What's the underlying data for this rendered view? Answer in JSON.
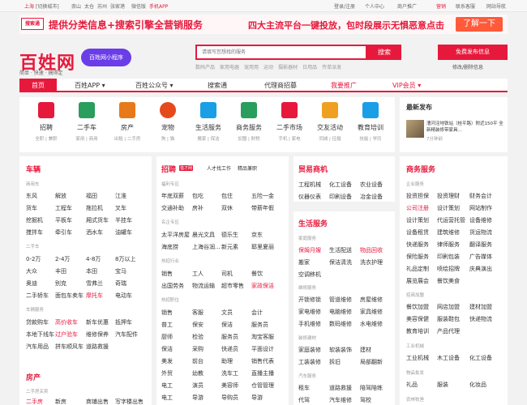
{
  "topbar": {
    "city": "上海",
    "switch": "[切换城市]",
    "areas": [
      "崇山",
      "太仓",
      "苏州",
      "张家港"
    ],
    "wechat": "微信版",
    "mobile": "手机APP",
    "right": [
      "登录/注册",
      "个人中心",
      "商户推广",
      "营销",
      "联系客服",
      "网站导航"
    ]
  },
  "banner": {
    "logo": "搜索通",
    "text1": "提供分类信息+搜索引擎全营销服务",
    "text2": "四大主流平台一键投放，包时段展示无惧恶意点击",
    "button": "了解一下"
  },
  "header": {
    "logo": "百姓网",
    "slogan": "简单 · 快速 · 搞得定",
    "mini": "百姓网小程序",
    "search_placeholder": "请填写您想找的服务",
    "search_button": "搜索",
    "hot": [
      "数码产品",
      "家用电器",
      "宠用用",
      "运动",
      "摄影器材",
      "日用品",
      "传单派发"
    ],
    "post_button": "免费发布信息",
    "post_sub": "修改/删除信息"
  },
  "nav": [
    "首页",
    "百姓APP ▾",
    "百姓公众号 ▾",
    "搜索通",
    "代理商招募",
    "我要推广",
    "VIP会员 ▾"
  ],
  "cats": [
    {
      "name": "招聘",
      "sub": "全职 | 兼职",
      "color": "#e6193c"
    },
    {
      "name": "二手车",
      "sub": "家用 | 商用",
      "color": "#2a9e5c"
    },
    {
      "name": "房产",
      "sub": "出租 | 二手房",
      "color": "#e67a1a"
    },
    {
      "name": "宠物",
      "sub": "狗 | 猫",
      "color": "#e64a1a"
    },
    {
      "name": "生活服务",
      "sub": "搬家 | 保洁",
      "color": "#1a9ee6"
    },
    {
      "name": "商务服务",
      "sub": "加盟 | 财税",
      "color": "#2a9e5c"
    },
    {
      "name": "二手市场",
      "sub": "手机 | 家电",
      "color": "#e6193c"
    },
    {
      "name": "交友活动",
      "sub": "同城 | 征婚",
      "color": "#f0a020"
    },
    {
      "name": "教育培训",
      "sub": "技能 | 学历",
      "color": "#1a9ee6"
    }
  ],
  "latest": {
    "title": "最新发布",
    "post": "漕河泾地铁站（桂平路）附近150平 全新精装修带家具...",
    "time": "7分钟前"
  },
  "col1": {
    "vehicle": {
      "title": "车辆",
      "sub1": "商用车",
      "row1": [
        "东风",
        "解放",
        "福田",
        "江淮"
      ],
      "row2": [
        "货车",
        "工程车",
        "拖拉机",
        "叉车"
      ],
      "row3": [
        "挖掘机",
        "平板车",
        "厢式货车",
        "半挂车"
      ],
      "row4": [
        "搅拌车",
        "牵引车",
        "洒水车",
        "油罐车"
      ],
      "sub2": "二手车",
      "row5": [
        "0-2万",
        "2-4万",
        "4-8万",
        "8万以上"
      ],
      "row6": [
        "大众",
        "丰田",
        "本田",
        "宝马"
      ],
      "row7": [
        "奥迪",
        "别克",
        "雪弗兰",
        "奇瑞"
      ],
      "row8": [
        "二手轿车",
        "面包车卖车",
        "摩托车",
        "电动车"
      ],
      "sub3": "车辆服务",
      "row9": [
        "贷款购车",
        "高价收车",
        "新车优惠",
        "抵押车"
      ],
      "row10": [
        "本地下线车",
        "过户验车",
        "维修保养",
        "汽车配件"
      ],
      "row11": [
        "汽车用品",
        "拼车顺风车",
        "道路救援"
      ]
    },
    "house": {
      "title": "房产",
      "sub1": "二手房买卖",
      "row1": [
        "二手房",
        "新房",
        "商铺出售",
        "写字楼出售"
      ]
    }
  },
  "col2": {
    "title": "招聘",
    "tab1": "猎才网",
    "tab2": "人才找工作",
    "tab3": "精品兼职",
    "sub1": "福利专区",
    "row1": [
      "年底双薪",
      "包吃",
      "包住",
      "五险一金"
    ],
    "row2": [
      "交通补助",
      "房补",
      "双休",
      "带薪年假"
    ],
    "sub2": "名企专区",
    "row3": [
      "太平洋房屋",
      "晨光文具",
      "德乐生",
      "京东"
    ],
    "row4": [
      "海底捞",
      "上海谷润...",
      "新元素",
      "耶里夏丽"
    ],
    "sub3": "热招行业",
    "row5": [
      "销售",
      "工人",
      "司机",
      "餐饮"
    ],
    "row6": [
      "出国劳务",
      "物流运输",
      "超市零售",
      "家政保洁"
    ],
    "sub4": "热招职位",
    "row7": [
      "销售",
      "客服",
      "文员",
      "会计"
    ],
    "row8": [
      "普工",
      "保安",
      "保洁",
      "服务员"
    ],
    "row9": [
      "厨师",
      "检验",
      "服务员",
      "淘宝客服"
    ],
    "row10": [
      "保洁",
      "采购",
      "快递员",
      "平面设计"
    ],
    "row11": [
      "美发",
      "前台",
      "助理",
      "销售代表"
    ],
    "row12": [
      "外贸",
      "幼教",
      "洗车工",
      "直播主播"
    ],
    "row13": [
      "电工",
      "演员",
      "美容师",
      "仓管管理"
    ],
    "row14": [
      "电工",
      "导游",
      "导购员",
      "导游"
    ]
  },
  "col3": {
    "trade": {
      "title": "贸易商机",
      "row1": [
        "工程机械",
        "化工设备",
        "农业设备"
      ],
      "row2": [
        "仪器仪表",
        "印刷设备",
        "冶金设备"
      ]
    },
    "life": {
      "title": "生活服务",
      "sub1": "家庭服务",
      "row1": [
        "保姆月嫂",
        "生活配送",
        "物品回收"
      ],
      "row2": [
        "搬家",
        "保洁清洗",
        "洗衣护理"
      ],
      "row3": [
        "空调移机"
      ],
      "sub2": "维修服务",
      "row4": [
        "开锁修锁",
        "管道维修",
        "房屋维修"
      ],
      "row5": [
        "家电维修",
        "电脑维修",
        "家具维修"
      ],
      "row6": [
        "手机维修",
        "数码维修",
        "水电维修"
      ],
      "sub3": "装修建材",
      "row7": [
        "家庭装修",
        "软装装饰",
        "建材"
      ],
      "row8": [
        "工装装修",
        "拆旧",
        "局部翻新"
      ],
      "sub4": "汽车服务",
      "row9": [
        "租车",
        "道路救援",
        "陪驾陪练"
      ],
      "row10": [
        "代驾",
        "汽车维修",
        "驾校"
      ]
    }
  },
  "col4": {
    "title": "商务服务",
    "sub1": "企业服务",
    "row1": [
      "投资担保",
      "投资理财",
      "财务会计"
    ],
    "row2": [
      "公司注册",
      "设计策划",
      "网站制作"
    ],
    "row3": [
      "设计策划",
      "代运营托管",
      "设备维修"
    ],
    "row4": [
      "设备租赁",
      "建筑维修",
      "货运物流"
    ],
    "row5": [
      "快递服务",
      "律师服务",
      "翻译服务"
    ],
    "row6": [
      "保险服务",
      "印刷包装",
      "广告媒体"
    ],
    "row7": [
      "礼品定制",
      "喷绘招牌",
      "庆典演出"
    ],
    "row8": [
      "展览展会",
      "餐饮美食"
    ],
    "sub2": "招商加盟",
    "row9": [
      "餐饮加盟",
      "网店加盟",
      "建材加盟"
    ],
    "row10": [
      "美容保健",
      "服装鞋包",
      "快递物流"
    ],
    "row11": [
      "教育培训",
      "产品代理"
    ],
    "sub3": "工业机械",
    "row12": [
      "工业机械",
      "木工设备",
      "化工设备"
    ],
    "sub4": "物品批发",
    "row13": [
      "礼品",
      "服装",
      "化妆品"
    ],
    "sub5": "农林牧渔"
  }
}
